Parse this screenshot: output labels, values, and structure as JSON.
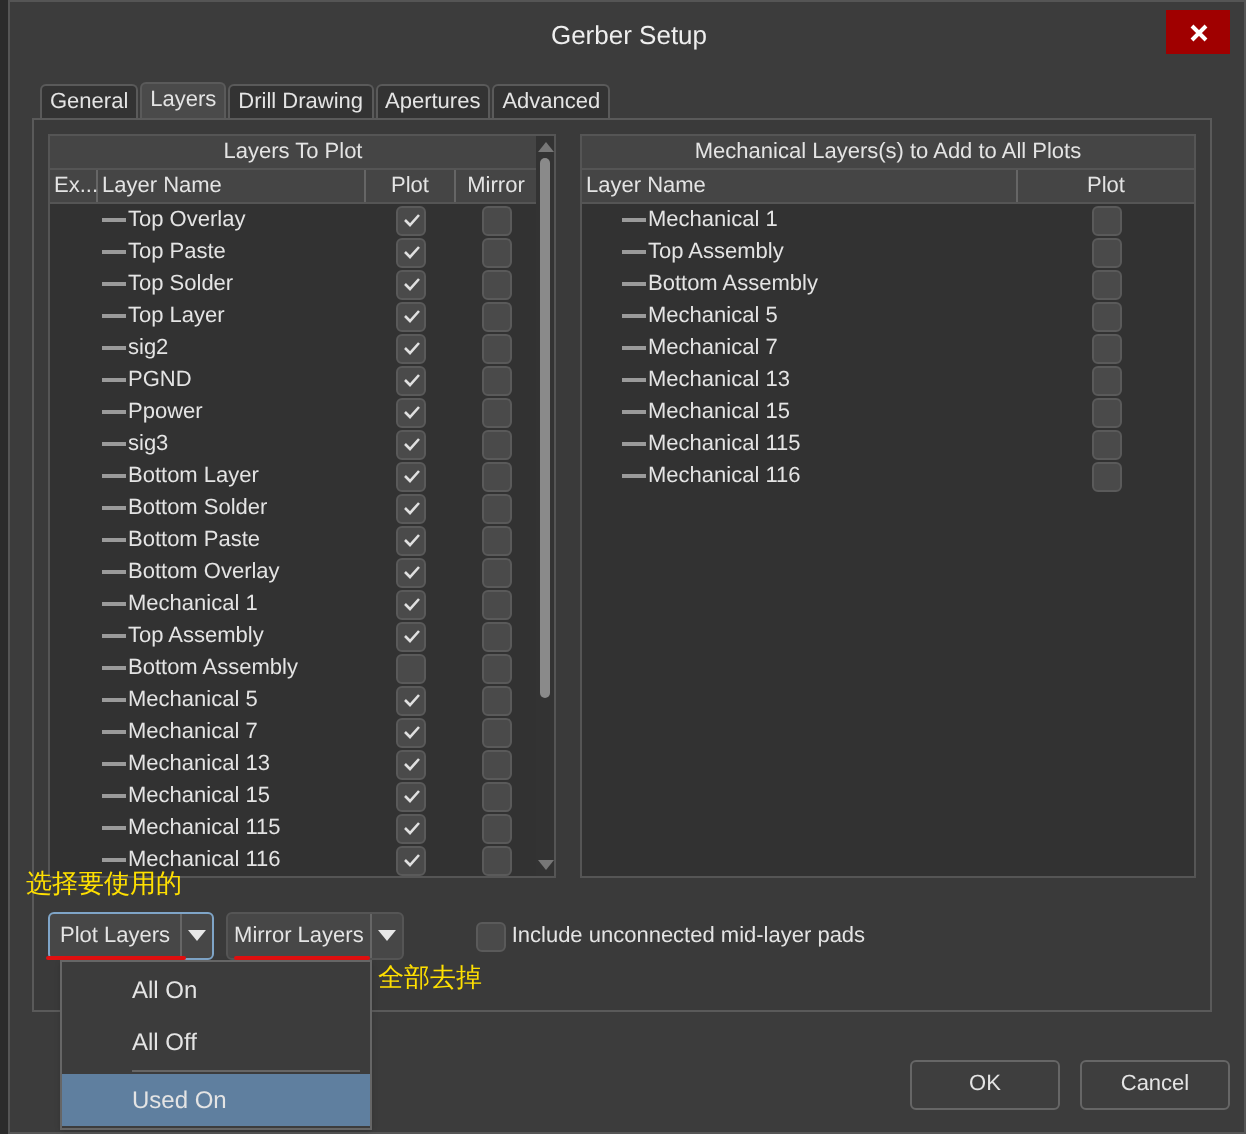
{
  "window": {
    "title": "Gerber Setup"
  },
  "tabs": [
    {
      "label": "General",
      "selected": false
    },
    {
      "label": "Layers",
      "selected": true
    },
    {
      "label": "Drill Drawing",
      "selected": false
    },
    {
      "label": "Apertures",
      "selected": false
    },
    {
      "label": "Advanced",
      "selected": false
    }
  ],
  "layers_to_plot": {
    "title": "Layers To Plot",
    "columns": [
      "Ex...",
      "Layer Name",
      "Plot",
      "Mirror"
    ],
    "rows": [
      {
        "name": "Top Overlay",
        "plot": true,
        "mirror": false
      },
      {
        "name": "Top Paste",
        "plot": true,
        "mirror": false
      },
      {
        "name": "Top Solder",
        "plot": true,
        "mirror": false
      },
      {
        "name": "Top Layer",
        "plot": true,
        "mirror": false
      },
      {
        "name": "sig2",
        "plot": true,
        "mirror": false
      },
      {
        "name": "PGND",
        "plot": true,
        "mirror": false
      },
      {
        "name": "Ppower",
        "plot": true,
        "mirror": false
      },
      {
        "name": "sig3",
        "plot": true,
        "mirror": false
      },
      {
        "name": "Bottom Layer",
        "plot": true,
        "mirror": false
      },
      {
        "name": "Bottom Solder",
        "plot": true,
        "mirror": false
      },
      {
        "name": "Bottom Paste",
        "plot": true,
        "mirror": false
      },
      {
        "name": "Bottom Overlay",
        "plot": true,
        "mirror": false
      },
      {
        "name": "Mechanical 1",
        "plot": true,
        "mirror": false
      },
      {
        "name": "Top Assembly",
        "plot": true,
        "mirror": false
      },
      {
        "name": "Bottom Assembly",
        "plot": false,
        "mirror": false
      },
      {
        "name": "Mechanical 5",
        "plot": true,
        "mirror": false
      },
      {
        "name": "Mechanical 7",
        "plot": true,
        "mirror": false
      },
      {
        "name": "Mechanical 13",
        "plot": true,
        "mirror": false
      },
      {
        "name": "Mechanical 15",
        "plot": true,
        "mirror": false
      },
      {
        "name": "Mechanical 115",
        "plot": true,
        "mirror": false
      },
      {
        "name": "Mechanical 116",
        "plot": true,
        "mirror": false
      }
    ]
  },
  "mechanical_layers": {
    "title": "Mechanical Layers(s) to Add to All Plots",
    "columns": [
      "Layer Name",
      "Plot"
    ],
    "rows": [
      {
        "name": "Mechanical 1",
        "plot": false
      },
      {
        "name": "Top Assembly",
        "plot": false
      },
      {
        "name": "Bottom Assembly",
        "plot": false
      },
      {
        "name": "Mechanical 5",
        "plot": false
      },
      {
        "name": "Mechanical 7",
        "plot": false
      },
      {
        "name": "Mechanical 13",
        "plot": false
      },
      {
        "name": "Mechanical 15",
        "plot": false
      },
      {
        "name": "Mechanical 115",
        "plot": false
      },
      {
        "name": "Mechanical 116",
        "plot": false
      }
    ]
  },
  "plot_layers_button": "Plot Layers",
  "mirror_layers_button": "Mirror Layers",
  "include_unconnected": {
    "label": "Include unconnected mid-layer pads",
    "checked": false
  },
  "menu": [
    {
      "label": "All On",
      "selected": false
    },
    {
      "label": "All Off",
      "selected": false
    },
    {
      "label": "Used On",
      "selected": true
    }
  ],
  "buttons": [
    "OK",
    "Cancel"
  ],
  "annotations": [
    "选择要使用的",
    "全部去掉"
  ]
}
